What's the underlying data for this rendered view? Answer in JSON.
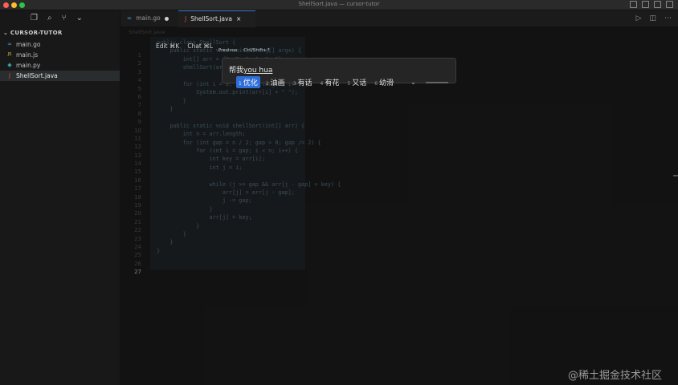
{
  "window": {
    "title": "ShellSort.java — cursor-tutor"
  },
  "explorer": {
    "section_title": "CURSOR-TUTOR",
    "files": [
      {
        "name": "main.go",
        "icon": "go-file-icon",
        "icon_glyph": "∞",
        "icon_color": "#4aa3c9"
      },
      {
        "name": "main.js",
        "icon": "js-file-icon",
        "icon_glyph": "JS",
        "icon_color": "#e8c93c"
      },
      {
        "name": "main.py",
        "icon": "python-file-icon",
        "icon_glyph": "◆",
        "icon_color": "#3c9ba5"
      },
      {
        "name": "ShellSort.java",
        "icon": "java-file-icon",
        "icon_glyph": "J",
        "icon_color": "#d04b4b",
        "active": true
      }
    ]
  },
  "tabs": [
    {
      "label": "main.go",
      "icon": "go-file-icon",
      "modified": true
    },
    {
      "label": "ShellSort.java",
      "icon": "java-file-icon",
      "close": "×",
      "active": true
    }
  ],
  "breadcrumb": "ShellSort.java",
  "line_numbers": [
    "1",
    "2",
    "3",
    "4",
    "5",
    "6",
    "7",
    "8",
    "9",
    "10",
    "11",
    "12",
    "13",
    "14",
    "15",
    "16",
    "17",
    "18",
    "19",
    "20",
    "21",
    "22",
    "23",
    "24",
    "25",
    "26",
    "27"
  ],
  "current_line": "27",
  "code_lines": [
    "public class ShellSort {",
    "    public static void main(String[] args) {",
    "        int[] arr = {5, 2, 9, 1, 5, 6};",
    "        shellSort(arr);",
    "",
    "        for (int i = 0; i < arr.length; i++) {",
    "            System.out.print(arr[i] + \" \");",
    "        }",
    "    }",
    "",
    "    public static void shellSort(int[] arr) {",
    "        int n = arr.length;",
    "        for (int gap = n / 2; gap > 0; gap /= 2) {",
    "            for (int i = gap; i < n; i++) {",
    "                int key = arr[i];",
    "                int j = i;",
    "",
    "                while (j >= gap && arr[j - gap] > key) {",
    "                    arr[j] = arr[j - gap];",
    "                    j -= gap;",
    "                }",
    "                arr[j] = key;",
    "            }",
    "        }",
    "    }",
    "}",
    ""
  ],
  "inline_edit": {
    "edit_label": "Edit ⌘K",
    "chat_label": "Chat ⌘L",
    "previous_label": "Previous",
    "shortcut": "Ctrl/Shift+↑",
    "prompt_prefix": "帮我",
    "prompt_composing": "you hua"
  },
  "ime": {
    "candidates": [
      {
        "num": "1",
        "text": "优化",
        "selected": true
      },
      {
        "num": "2",
        "text": "油画"
      },
      {
        "num": "3",
        "text": "有话"
      },
      {
        "num": "4",
        "text": "有花"
      },
      {
        "num": "5",
        "text": "又话"
      },
      {
        "num": "6",
        "text": "幼滑"
      }
    ]
  },
  "watermark": "@稀土掘金技术社区",
  "colors": {
    "accent": "#2f6ed9",
    "selection": "#23292c"
  }
}
